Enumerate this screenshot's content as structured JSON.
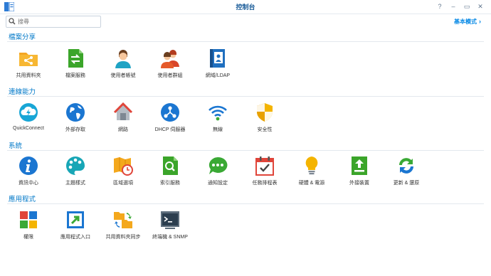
{
  "window": {
    "title": "控制台",
    "help": "?",
    "minimize": "–",
    "maximize": "▭",
    "close": "✕"
  },
  "search": {
    "placeholder": "搜尋"
  },
  "basic_mode": {
    "label": "基本模式",
    "chevron": "›"
  },
  "sections": [
    {
      "title": "檔案分享",
      "items": [
        {
          "label": "共用資料夾",
          "icon": "shared-folder-icon"
        },
        {
          "label": "檔案服務",
          "icon": "file-services-icon"
        },
        {
          "label": "使用者帳號",
          "icon": "user-icon"
        },
        {
          "label": "使用者群組",
          "icon": "group-icon"
        },
        {
          "label": "網域/LDAP",
          "icon": "domain-ldap-icon"
        }
      ]
    },
    {
      "title": "連線能力",
      "items": [
        {
          "label": "QuickConnect",
          "icon": "quickconnect-icon"
        },
        {
          "label": "外部存取",
          "icon": "external-access-icon"
        },
        {
          "label": "網路",
          "icon": "network-icon"
        },
        {
          "label": "DHCP 伺服器",
          "icon": "dhcp-server-icon"
        },
        {
          "label": "無線",
          "icon": "wireless-icon"
        },
        {
          "label": "安全性",
          "icon": "security-icon"
        }
      ]
    },
    {
      "title": "系統",
      "items": [
        {
          "label": "資訊中心",
          "icon": "info-center-icon"
        },
        {
          "label": "主題樣式",
          "icon": "theme-icon"
        },
        {
          "label": "區域選項",
          "icon": "regional-options-icon"
        },
        {
          "label": "索引服務",
          "icon": "indexing-service-icon"
        },
        {
          "label": "通知設定",
          "icon": "notification-icon"
        },
        {
          "label": "任務排程表",
          "icon": "task-scheduler-icon"
        },
        {
          "label": "硬體 & 電源",
          "icon": "hardware-power-icon"
        },
        {
          "label": "外接裝置",
          "icon": "external-devices-icon"
        },
        {
          "label": "更新 & 還原",
          "icon": "update-restore-icon"
        }
      ]
    },
    {
      "title": "應用程式",
      "items": [
        {
          "label": "權限",
          "icon": "privileges-icon"
        },
        {
          "label": "應用程式入口",
          "icon": "application-portal-icon"
        },
        {
          "label": "共用資料夾同步",
          "icon": "shared-folder-sync-icon"
        },
        {
          "label": "終端機 & SNMP",
          "icon": "terminal-snmp-icon"
        }
      ]
    }
  ],
  "colors": {
    "section_title": "#0078c8",
    "accent": "#0086e5",
    "window_title": "#1a5c99"
  }
}
